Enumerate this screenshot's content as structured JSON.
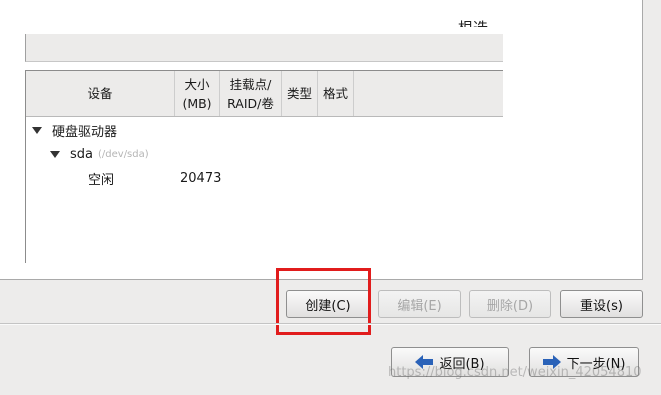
{
  "header": {
    "cut_text": "根选"
  },
  "table": {
    "columns": [
      {
        "label": "设备"
      },
      {
        "label": "大小\n(MB)"
      },
      {
        "label": "挂载点/\nRAID/卷"
      },
      {
        "label": "类型"
      },
      {
        "label": "格式"
      }
    ],
    "rows": [
      {
        "device": "硬盘驱动器",
        "size": ""
      },
      {
        "device": "sda",
        "hint": "(/dev/sda)",
        "size": ""
      },
      {
        "device": "空闲",
        "size": "20473"
      }
    ]
  },
  "actions": {
    "create": "创建(C)",
    "edit": "编辑(E)",
    "delete": "删除(D)",
    "reset": "重设(s)"
  },
  "nav": {
    "back": "返回(B)",
    "next": "下一步(N)"
  },
  "watermark": "https://blog.csdn.net/weixin_42054810",
  "colors": {
    "highlight": "#e11c1c",
    "arrow": "#2a62b8"
  }
}
